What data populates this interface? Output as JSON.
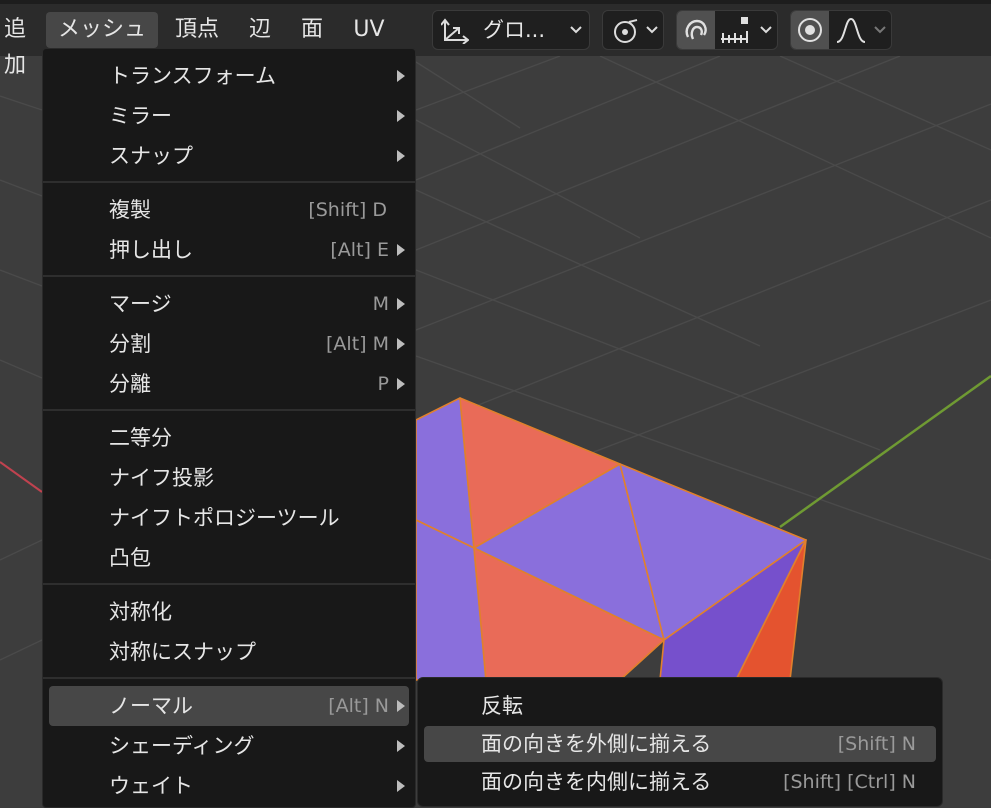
{
  "header": {
    "menus": [
      {
        "label": "追加"
      },
      {
        "label": "メッシュ"
      },
      {
        "label": "頂点"
      },
      {
        "label": "辺"
      },
      {
        "label": "面"
      },
      {
        "label": "UV"
      }
    ],
    "transform_orientation": "グロ...",
    "snap_active": true,
    "proportional_edit_active": true
  },
  "mesh_menu": {
    "groups": [
      [
        {
          "label": "トランスフォーム",
          "shortcut": "",
          "submenu": true
        },
        {
          "label": "ミラー",
          "shortcut": "",
          "submenu": true
        },
        {
          "label": "スナップ",
          "shortcut": "",
          "submenu": true
        }
      ],
      [
        {
          "label": "複製",
          "shortcut": "[Shift] D",
          "submenu": false
        },
        {
          "label": "押し出し",
          "shortcut": "[Alt] E",
          "submenu": true
        }
      ],
      [
        {
          "label": "マージ",
          "shortcut": "M",
          "submenu": true
        },
        {
          "label": "分割",
          "shortcut": "[Alt] M",
          "submenu": true
        },
        {
          "label": "分離",
          "shortcut": "P",
          "submenu": true
        }
      ],
      [
        {
          "label": "二等分",
          "shortcut": "",
          "submenu": false
        },
        {
          "label": "ナイフ投影",
          "shortcut": "",
          "submenu": false
        },
        {
          "label": "ナイフトポロジーツール",
          "shortcut": "",
          "submenu": false
        },
        {
          "label": "凸包",
          "shortcut": "",
          "submenu": false
        }
      ],
      [
        {
          "label": "対称化",
          "shortcut": "",
          "submenu": false
        },
        {
          "label": "対称にスナップ",
          "shortcut": "",
          "submenu": false
        }
      ],
      [
        {
          "label": "ノーマル",
          "shortcut": "[Alt] N",
          "submenu": true,
          "highlighted": true
        },
        {
          "label": "シェーディング",
          "shortcut": "",
          "submenu": true
        },
        {
          "label": "ウェイト",
          "shortcut": "",
          "submenu": true
        }
      ]
    ]
  },
  "normals_submenu": {
    "items": [
      {
        "label": "反転",
        "shortcut": ""
      },
      {
        "label": "面の向きを外側に揃える",
        "shortcut": "[Shift] N",
        "highlighted": true
      },
      {
        "label": "面の向きを内側に揃える",
        "shortcut": "[Shift] [Ctrl] N"
      }
    ]
  },
  "colors": {
    "face_purple": "#8a6fdc",
    "face_purple_dark": "#7650cc",
    "face_orange": "#e96b58",
    "face_orange_bright": "#e4532f",
    "edge_orange": "#e0802c",
    "axis_y_green": "#6f9a33",
    "axis_x_red": "#c0424f"
  }
}
